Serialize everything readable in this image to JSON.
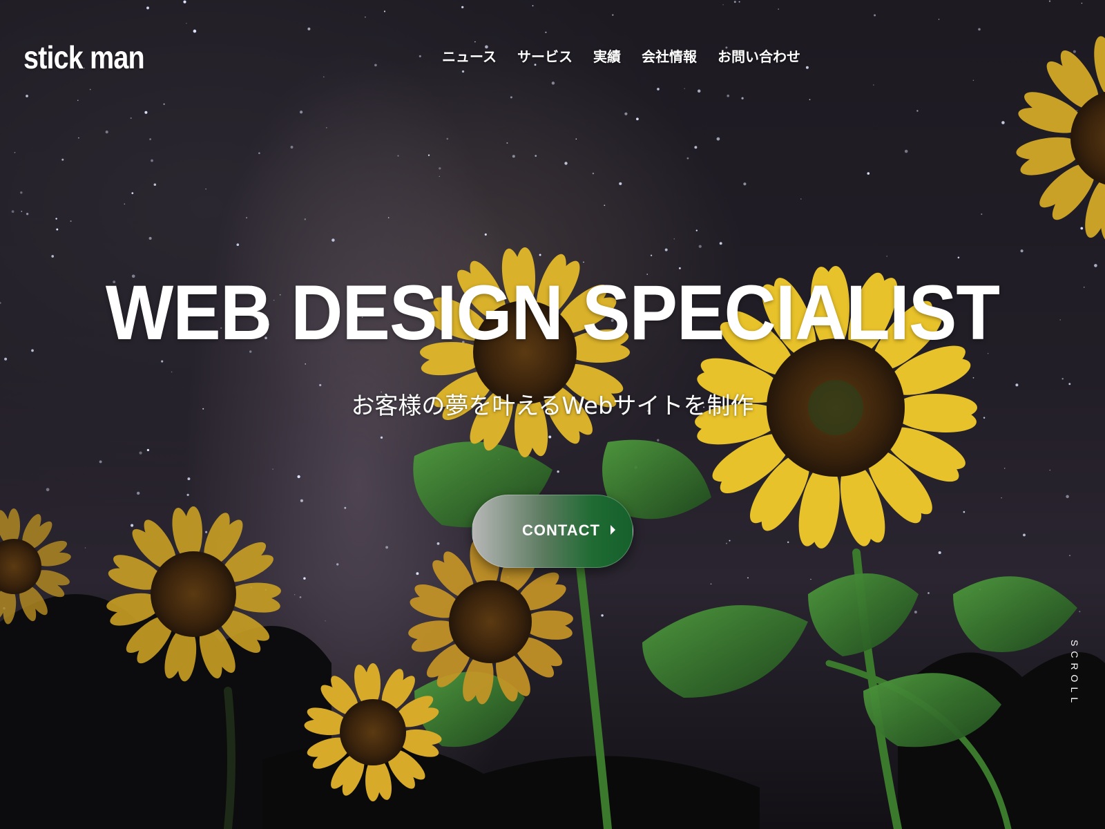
{
  "header": {
    "logo": "stick man",
    "nav": [
      "ニュース",
      "サービス",
      "実績",
      "会社情報",
      "お問い合わせ"
    ]
  },
  "hero": {
    "headline": "WEB DESIGN SPECIALIST",
    "subline": "お客様の夢を叶えるWebサイトを制作",
    "cta_label": "CONTACT",
    "scroll_label": "SCROLL",
    "background": "night-sky-sunflowers-photo"
  },
  "colors": {
    "cta_gradient_start": "#b7b7b7",
    "cta_gradient_end": "#16602c",
    "text": "#ffffff",
    "sunflower_petal": "#e8c22a",
    "leaf": "#3f8a35"
  }
}
